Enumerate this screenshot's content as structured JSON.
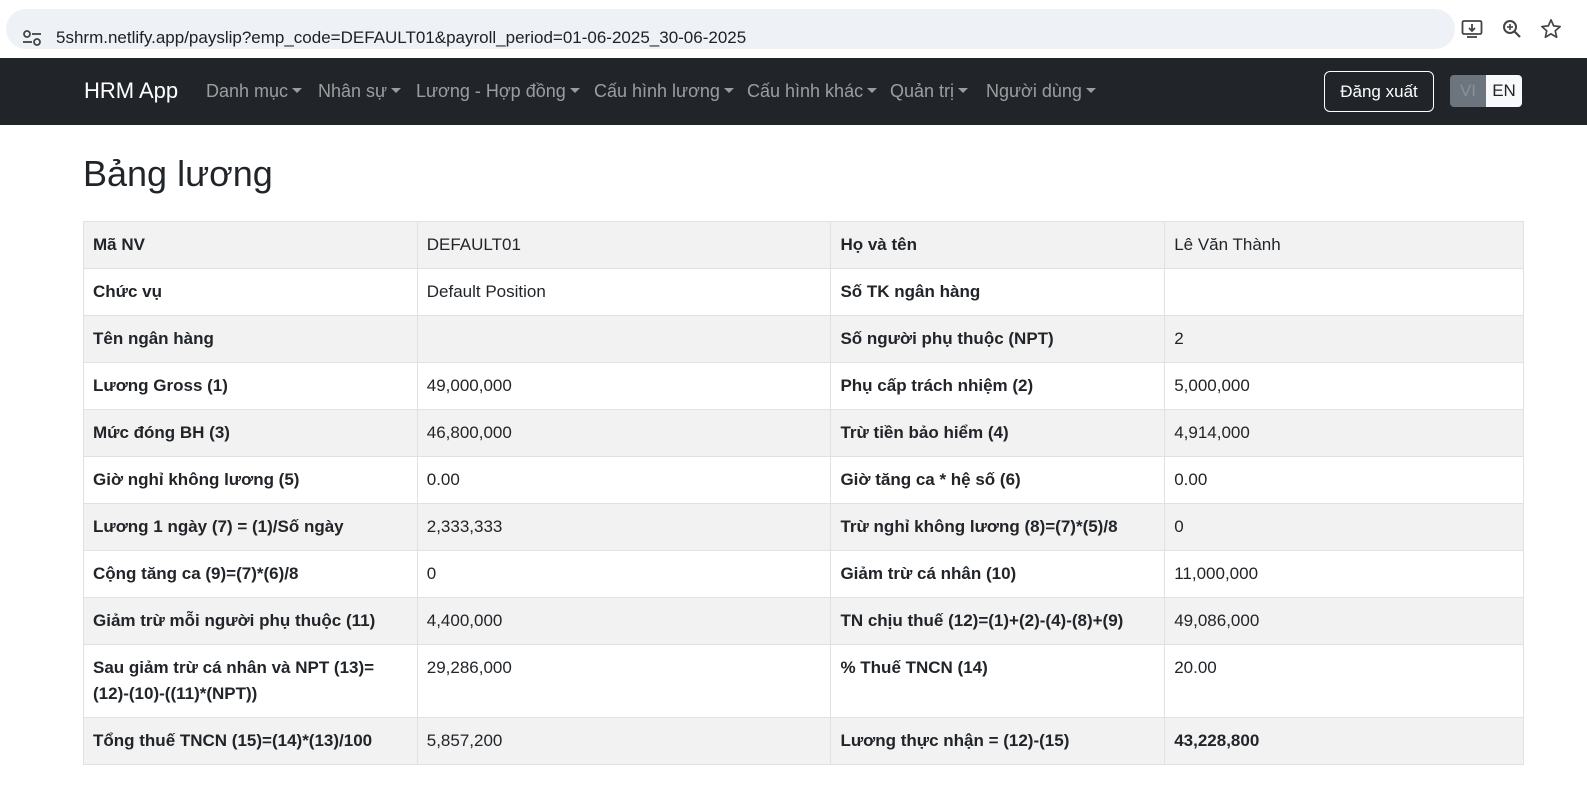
{
  "browser": {
    "url": "5shrm.netlify.app/payslip?emp_code=DEFAULT01&payroll_period=01-06-2025_30-06-2025"
  },
  "navbar": {
    "brand": "HRM App",
    "menus": [
      "Danh mục",
      "Nhân sự",
      "Lương - Hợp đồng",
      "Cấu hình lương",
      "Cấu hình khác",
      "Quản trị",
      "Người dùng"
    ],
    "logout_label": "Đăng xuất",
    "lang_vi": "VI",
    "lang_en": "EN",
    "active_lang": "EN"
  },
  "page": {
    "title": "Bảng lương"
  },
  "payslip": {
    "rows": [
      {
        "label1": "Mã NV",
        "value1": "DEFAULT01",
        "label2": "Họ và tên",
        "value2": "Lê Văn Thành"
      },
      {
        "label1": "Chức vụ",
        "value1": "Default Position",
        "label2": "Số TK ngân hàng",
        "value2": ""
      },
      {
        "label1": "Tên ngân hàng",
        "value1": "",
        "label2": "Số người phụ thuộc (NPT)",
        "value2": "2"
      },
      {
        "label1": "Lương Gross (1)",
        "value1": "49,000,000",
        "label2": "Phụ cấp trách nhiệm (2)",
        "value2": "5,000,000"
      },
      {
        "label1": "Mức đóng BH (3)",
        "value1": "46,800,000",
        "label2": "Trừ tiền bảo hiểm (4)",
        "value2": "4,914,000"
      },
      {
        "label1": "Giờ nghỉ không lương (5)",
        "value1": "0.00",
        "label2": "Giờ tăng ca * hệ số (6)",
        "value2": "0.00"
      },
      {
        "label1": "Lương 1 ngày (7) = (1)/Số ngày",
        "value1": "2,333,333",
        "label2": "Trừ nghỉ không lương (8)=(7)*(5)/8",
        "value2": "0"
      },
      {
        "label1": "Cộng tăng ca (9)=(7)*(6)/8",
        "value1": "0",
        "label2": "Giảm trừ cá nhân (10)",
        "value2": "11,000,000"
      },
      {
        "label1": "Giảm trừ mỗi người phụ thuộc (11)",
        "value1": "4,400,000",
        "label2": "TN chịu thuế (12)=(1)+(2)-(4)-(8)+(9)",
        "value2": "49,086,000"
      },
      {
        "label1": "Sau giảm trừ cá nhân và NPT (13)=(12)-(10)-((11)*(NPT))",
        "value1": "29,286,000",
        "label2": "% Thuế TNCN (14)",
        "value2": "20.00"
      },
      {
        "label1": "Tổng thuế TNCN (15)=(14)*(13)/100",
        "value1": "5,857,200",
        "label2": "Lương thực nhận = (12)-(15)",
        "value2": "43,228,800"
      }
    ]
  },
  "icons": {
    "site_info": "tune-icon",
    "install": "install-app-icon",
    "zoom": "zoom-icon",
    "bookmark": "star-icon"
  }
}
